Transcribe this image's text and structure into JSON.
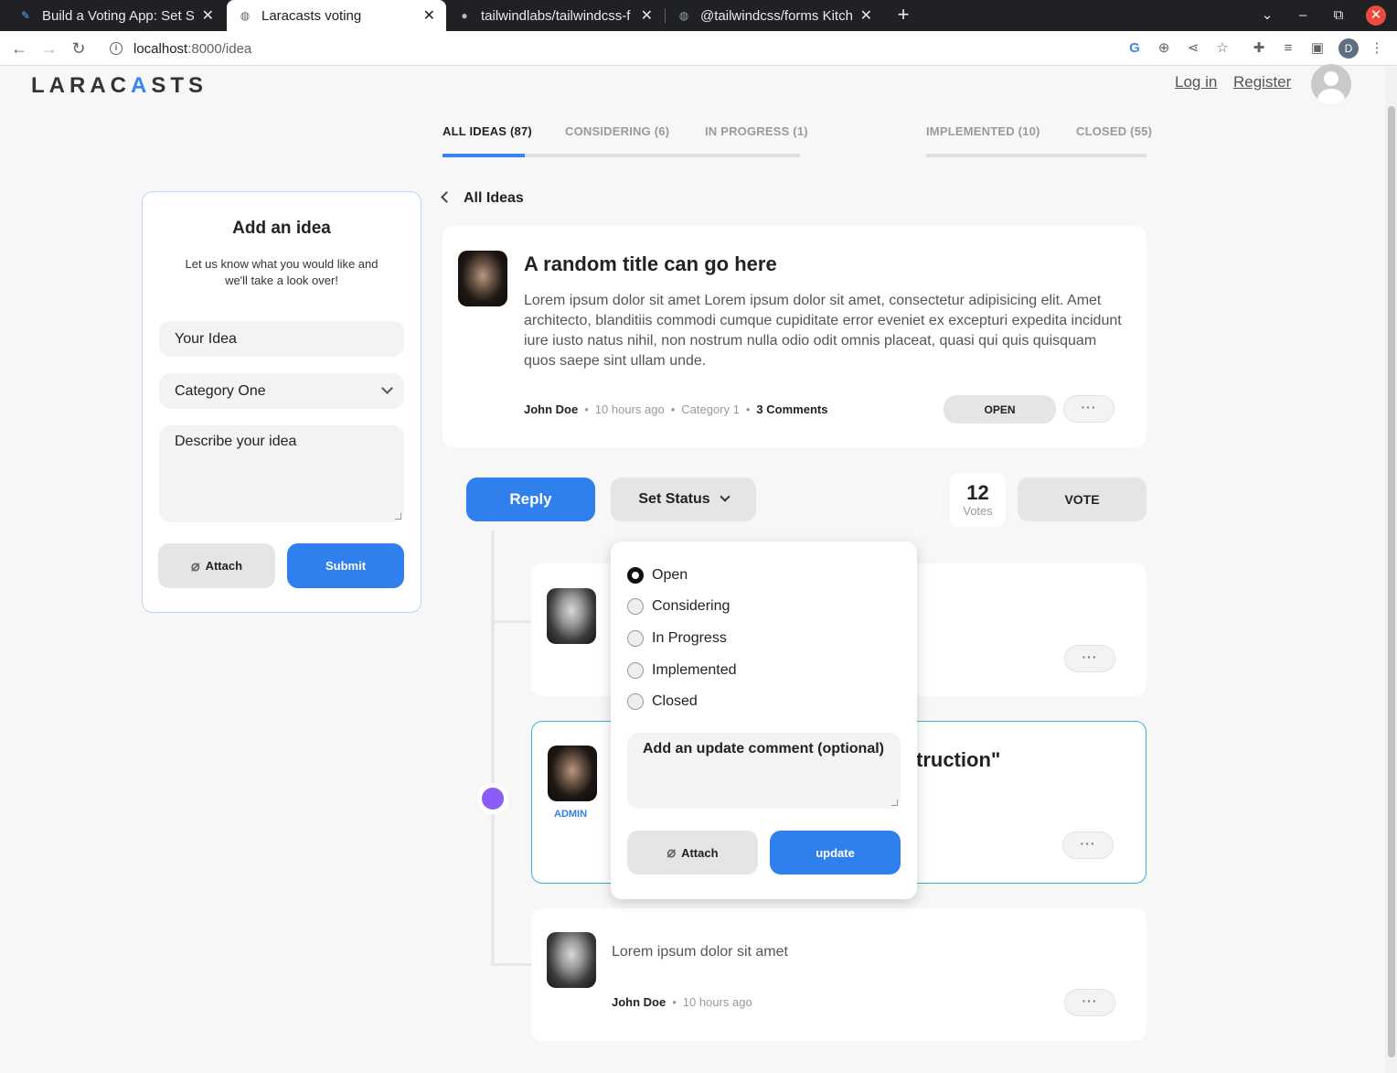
{
  "browser": {
    "tabs": [
      {
        "title": "Build a Voting App: Set St",
        "icon": "feather-icon"
      },
      {
        "title": "Laracasts voting",
        "icon": "globe-icon"
      },
      {
        "title": "tailwindlabs/tailwindcss-f",
        "icon": "github-icon"
      },
      {
        "title": "@tailwindcss/forms Kitch",
        "icon": "globe-icon"
      }
    ],
    "url_host": "localhost",
    "url_path": ":8000/idea",
    "profile_initial": "D"
  },
  "header": {
    "logo_left": "LARAC",
    "logo_accent": "A",
    "logo_right": "STS",
    "login": "Log in",
    "register": "Register"
  },
  "filters": {
    "all": "ALL IDEAS (87)",
    "considering": "CONSIDERING (6)",
    "in_progress": "IN PROGRESS (1)",
    "implemented": "IMPLEMENTED (10)",
    "closed": "CLOSED (55)"
  },
  "add_idea": {
    "title": "Add an idea",
    "subtitle": "Let us know what you would like and we'll take a look over!",
    "idea_placeholder": "Your Idea",
    "category": "Category One",
    "description_placeholder": "Describe your idea",
    "attach": "Attach",
    "submit": "Submit"
  },
  "idea": {
    "back": "All Ideas",
    "title": "A random title can go here",
    "body": "Lorem ipsum dolor sit amet Lorem ipsum dolor sit amet, consectetur adipisicing elit. Amet architecto, blanditiis commodi cumque cupiditate error eveniet ex excepturi expedita incidunt iure iusto natus nihil, non nostrum nulla odio odit omnis placeat, quasi qui quis quisquam quos saepe sint ullam unde.",
    "author": "John Doe",
    "time": "10 hours ago",
    "category": "Category 1",
    "comments": "3 Comments",
    "status": "OPEN",
    "more": "···"
  },
  "actions": {
    "reply": "Reply",
    "set_status": "Set Status",
    "votes_count": "12",
    "votes_label": "Votes",
    "vote": "VOTE"
  },
  "status_dropdown": {
    "options": [
      "Open",
      "Considering",
      "In Progress",
      "Implemented",
      "Closed"
    ],
    "selected": "Open",
    "comment_placeholder": "Add an update comment (optional)",
    "attach": "Attach",
    "update": "update"
  },
  "comments": {
    "admin_label": "ADMIN",
    "admin_partial_title": "truction\"",
    "last_text": "Lorem ipsum dolor sit amet",
    "last_author": "John Doe",
    "last_time": "10 hours ago",
    "more": "···"
  },
  "colors": {
    "primary": "#2f80ed",
    "admin_border": "#3ab0d8",
    "status_dot": "#8b5cf6"
  }
}
